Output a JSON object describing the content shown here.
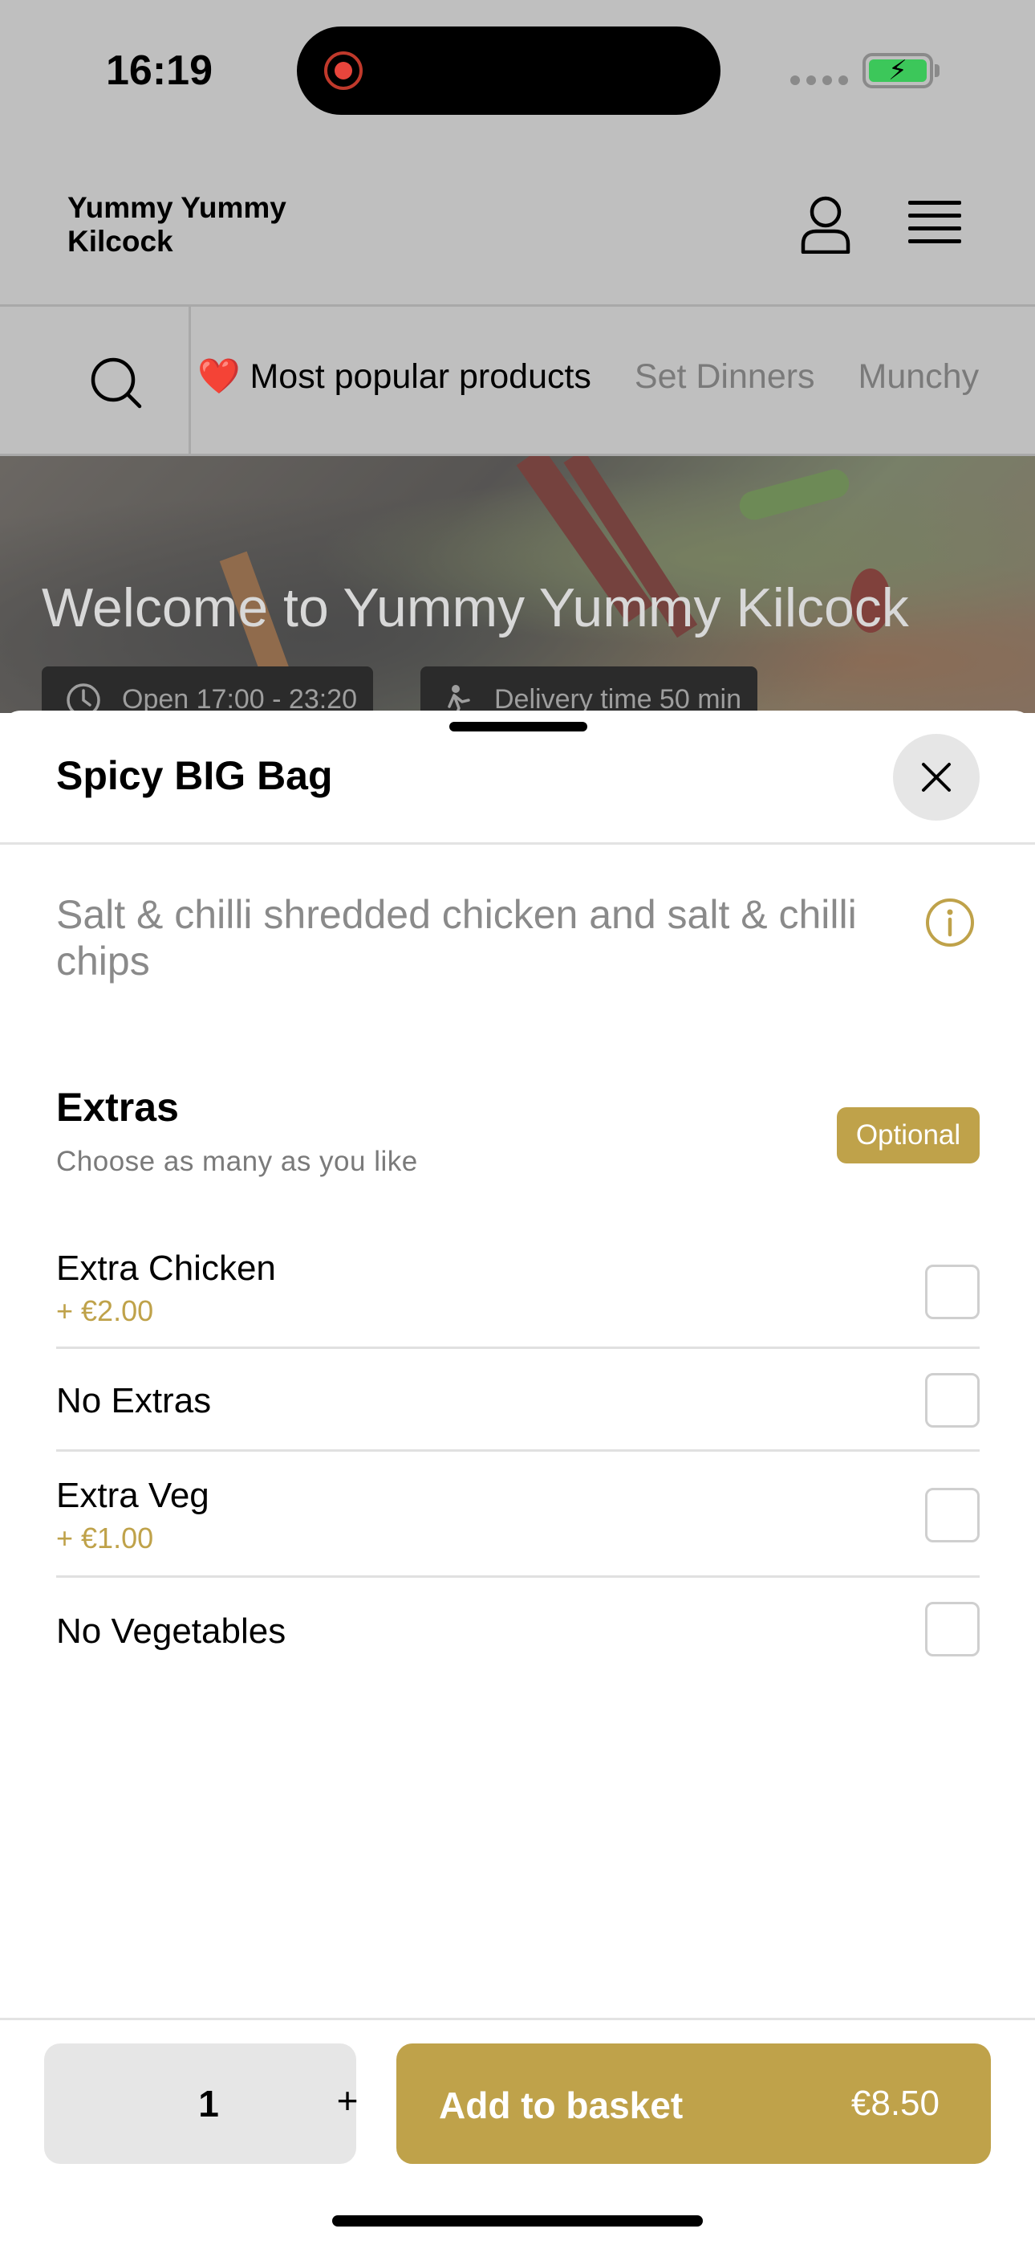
{
  "status_bar": {
    "time": "16:19"
  },
  "header": {
    "brand": "Yummy Yummy Kilcock"
  },
  "categories": {
    "tabs": [
      {
        "label": "❤️ Most popular products",
        "active": true
      },
      {
        "label": "Set Dinners",
        "active": false
      },
      {
        "label": "Munchy",
        "active": false
      }
    ]
  },
  "hero": {
    "title": "Welcome to Yummy Yummy Kilcock",
    "open_hours": "Open 17:00 - 23:20",
    "delivery_time": "Delivery time 50 min"
  },
  "product": {
    "title": "Spicy BIG Bag",
    "description": "Salt & chilli shredded chicken and salt & chilli chips"
  },
  "extras": {
    "title": "Extras",
    "subtitle": "Choose as many as you like",
    "badge": "Optional",
    "options": [
      {
        "name": "Extra Chicken",
        "price": "+ €2.00",
        "checked": false
      },
      {
        "name": "No Extras",
        "price": "",
        "checked": false
      },
      {
        "name": "Extra Veg",
        "price": "+ €1.00",
        "checked": false
      },
      {
        "name": "No Vegetables",
        "price": "",
        "checked": false
      }
    ]
  },
  "footer": {
    "quantity": "1",
    "plus_label": "+",
    "add_label": "Add to basket",
    "total": "€8.50"
  },
  "colors": {
    "accent": "#bfa24a",
    "overlay": "#bfbfbf"
  }
}
